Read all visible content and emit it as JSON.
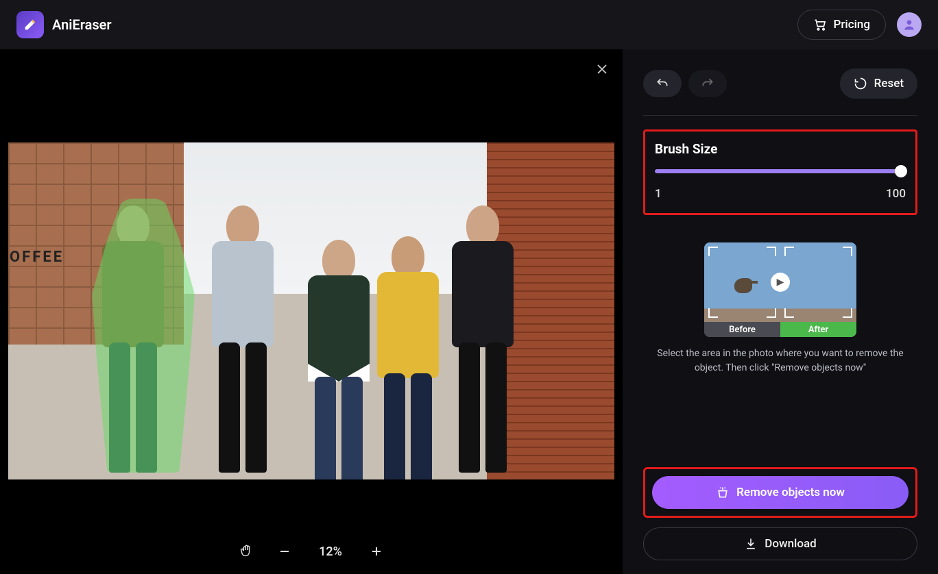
{
  "app": {
    "title": "AniEraser"
  },
  "header": {
    "pricing_label": "Pricing"
  },
  "sidebar": {
    "reset_label": "Reset",
    "brush_label": "Brush Size",
    "slider_min": "1",
    "slider_max": "100",
    "slider_value": 100,
    "preview_before": "Before",
    "preview_after": "After",
    "hint": "Select the area in the photo where you want to remove the object. Then click \"Remove objects now\"",
    "remove_label": "Remove objects now",
    "download_label": "Download"
  },
  "canvas": {
    "zoom_label": "12%",
    "coffee_sign": "OFFEE"
  }
}
